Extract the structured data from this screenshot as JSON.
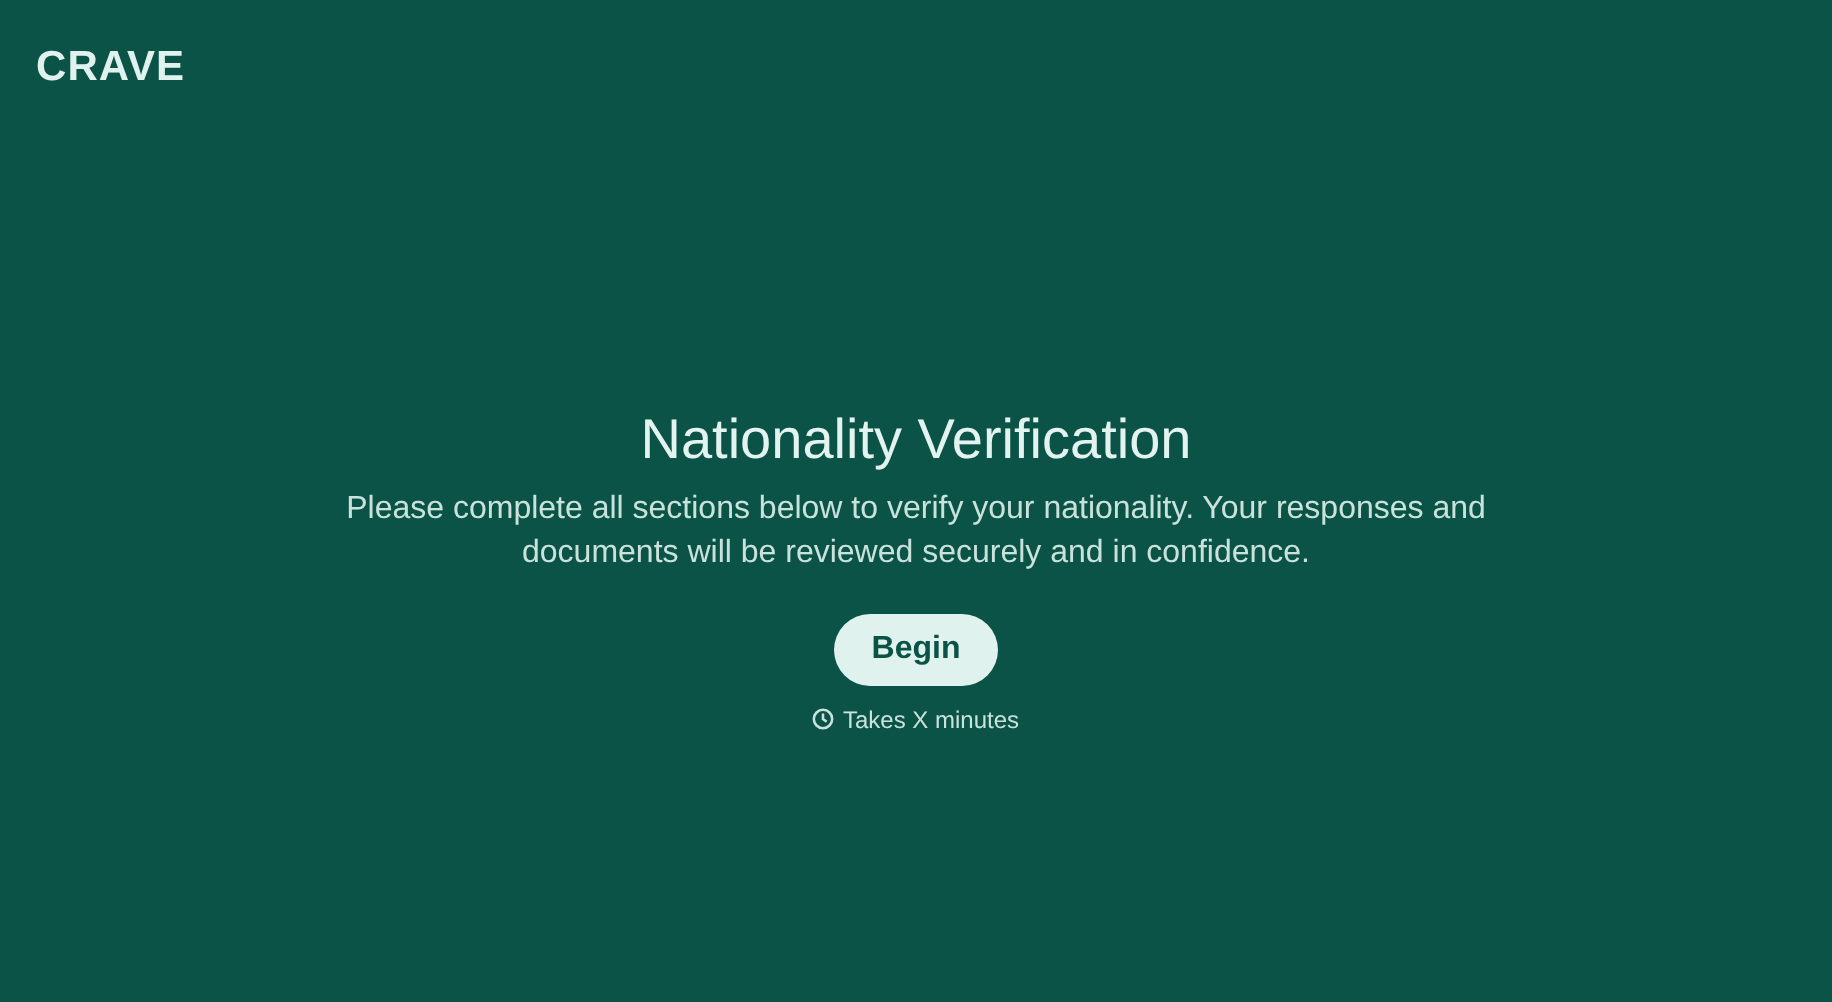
{
  "logo": "CRAVE",
  "title": "Nationality Verification",
  "description": "Please complete all sections below to verify your nationality. Your responses and documents will be reviewed securely and in confidence.",
  "button": "Begin",
  "duration": "Takes X minutes"
}
